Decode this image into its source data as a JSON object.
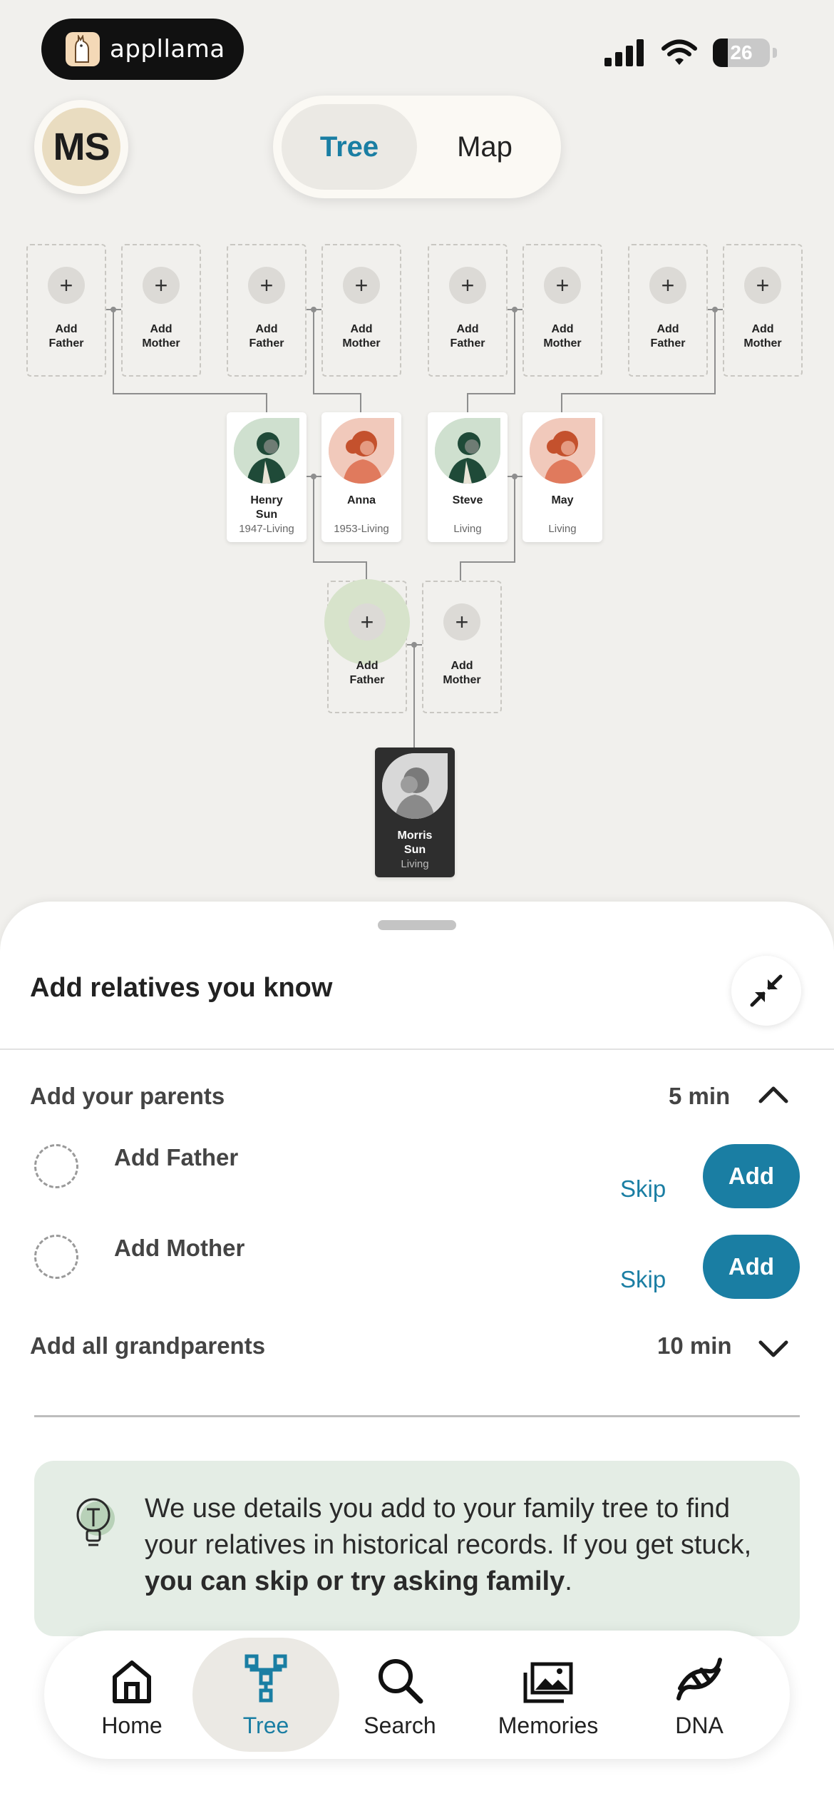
{
  "status_bar": {
    "app_name": "appllama",
    "battery": "26"
  },
  "header": {
    "avatar_initials": "MS",
    "tabs": [
      {
        "label": "Tree",
        "active": true
      },
      {
        "label": "Map",
        "active": false
      }
    ]
  },
  "tree": {
    "gen3": [
      {
        "label": "Add\nFather"
      },
      {
        "label": "Add\nMother"
      },
      {
        "label": "Add\nFather"
      },
      {
        "label": "Add\nMother"
      },
      {
        "label": "Add\nFather"
      },
      {
        "label": "Add\nMother"
      },
      {
        "label": "Add\nFather"
      },
      {
        "label": "Add\nMother"
      }
    ],
    "gen2": [
      {
        "name": "Henry\nSun",
        "dates": "1947-Living",
        "gender": "male"
      },
      {
        "name": "Anna",
        "dates": "1953-Living",
        "gender": "female"
      },
      {
        "name": "Steve",
        "dates": "Living",
        "gender": "male"
      },
      {
        "name": "May",
        "dates": "Living",
        "gender": "female"
      }
    ],
    "gen1": [
      {
        "label": "Add\nFather"
      },
      {
        "label": "Add\nMother"
      }
    ],
    "self": {
      "name": "Morris\nSun",
      "dates": "Living"
    }
  },
  "sheet": {
    "title": "Add relatives you know",
    "parents_section": {
      "title": "Add your parents",
      "duration": "5 min"
    },
    "relatives": [
      {
        "name": "Add Father",
        "skip": "Skip",
        "add": "Add"
      },
      {
        "name": "Add Mother",
        "skip": "Skip",
        "add": "Add"
      }
    ],
    "grandparents_section": {
      "title": "Add all grandparents",
      "duration": "10 min"
    },
    "tip": {
      "text_plain": "We use details you add to your family tree to find your relatives in historical records. If you get stuck, ",
      "text_bold": "you can skip or try asking family",
      "text_end": "."
    }
  },
  "nav": [
    {
      "label": "Home",
      "icon": "home-icon"
    },
    {
      "label": "Tree",
      "icon": "tree-icon",
      "active": true
    },
    {
      "label": "Search",
      "icon": "search-icon"
    },
    {
      "label": "Memories",
      "icon": "photos-icon"
    },
    {
      "label": "DNA",
      "icon": "dna-icon"
    }
  ],
  "colors": {
    "accent": "#1a7ea3",
    "background": "#f1f0ed",
    "tip_bg": "#e4ede5",
    "self_card": "#2e2e2e"
  }
}
